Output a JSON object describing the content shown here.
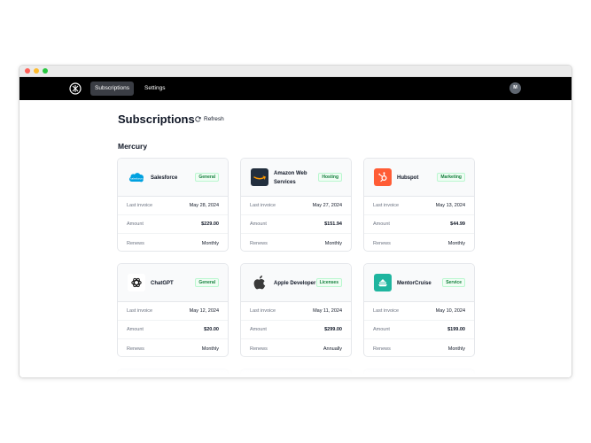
{
  "nav": {
    "tabs": [
      {
        "label": "Subscriptions",
        "active": true
      },
      {
        "label": "Settings",
        "active": false
      }
    ],
    "avatar_initial": "M"
  },
  "page": {
    "title": "Subscriptions",
    "refresh_label": "Refresh",
    "group_title": "Mercury"
  },
  "row_labels": {
    "last_invoice": "Last invoice",
    "amount": "Amount",
    "renews": "Renews"
  },
  "subscriptions": [
    {
      "name": "Salesforce",
      "badge": "General",
      "last_invoice": "May 28, 2024",
      "amount": "$229.00",
      "renews": "Monthly",
      "icon": "salesforce-cloud-icon"
    },
    {
      "name": "Amazon Web Services",
      "badge": "Hosting",
      "last_invoice": "May 27, 2024",
      "amount": "$151.94",
      "renews": "Monthly",
      "icon": "aws-icon"
    },
    {
      "name": "Hubspot",
      "badge": "Marketing",
      "last_invoice": "May 13, 2024",
      "amount": "$44.99",
      "renews": "Monthly",
      "icon": "hubspot-icon"
    },
    {
      "name": "ChatGPT",
      "badge": "General",
      "last_invoice": "May 12, 2024",
      "amount": "$20.00",
      "renews": "Monthly",
      "icon": "openai-icon"
    },
    {
      "name": "Apple Developer",
      "badge": "Licenses",
      "last_invoice": "May 11, 2024",
      "amount": "$299.00",
      "renews": "Annually",
      "icon": "apple-icon"
    },
    {
      "name": "MentorCruise",
      "badge": "Service",
      "last_invoice": "May 10, 2024",
      "amount": "$199.00",
      "renews": "Monthly",
      "icon": "mentorcruise-icon"
    }
  ],
  "colors": {
    "nav_bg": "#000000",
    "badge_green": "#15803d",
    "salesforce_blue": "#00a1e0",
    "aws_dark": "#232f3e",
    "aws_orange": "#ff9900",
    "hubspot_orange": "#ff5c35",
    "mentorcruise_teal": "#1fb59f"
  }
}
